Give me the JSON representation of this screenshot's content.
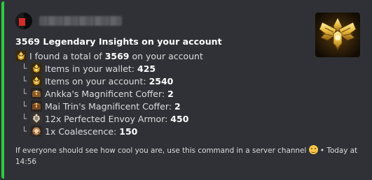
{
  "embed": {
    "accent_color": "#2ecc40",
    "author": {
      "name": ""
    },
    "thumbnail": {
      "icon": "gold-winged-emblem-icon"
    },
    "title": "3569 Legendary Insights on your account",
    "summary": {
      "prefix": "I found a total of ",
      "value": "3569",
      "suffix": " on your account"
    },
    "items": [
      {
        "branch": "└",
        "icon": "legendary-insight-icon",
        "label": "Items in your wallet: ",
        "value": "425"
      },
      {
        "branch": "└",
        "icon": "legendary-insight-icon",
        "label": "Items on your account: ",
        "value": "2540"
      },
      {
        "branch": "└",
        "icon": "coffer-icon",
        "label": "Ankka's Magnificent Coffer: ",
        "value": "2"
      },
      {
        "branch": "└",
        "icon": "coffer-icon",
        "label": "Mai Trin's Magnificent Coffer: ",
        "value": "2"
      },
      {
        "branch": "└",
        "icon": "armor-icon",
        "label": "12x Perfected Envoy Armor: ",
        "value": "450"
      },
      {
        "branch": "└",
        "icon": "coalescence-icon",
        "label": "1x Coalescence: ",
        "value": "150"
      }
    ],
    "footer": {
      "text": "If everyone should see how cool you are, use this command in a server channel",
      "separator": " • ",
      "timestamp": "Today at 14:56"
    }
  }
}
